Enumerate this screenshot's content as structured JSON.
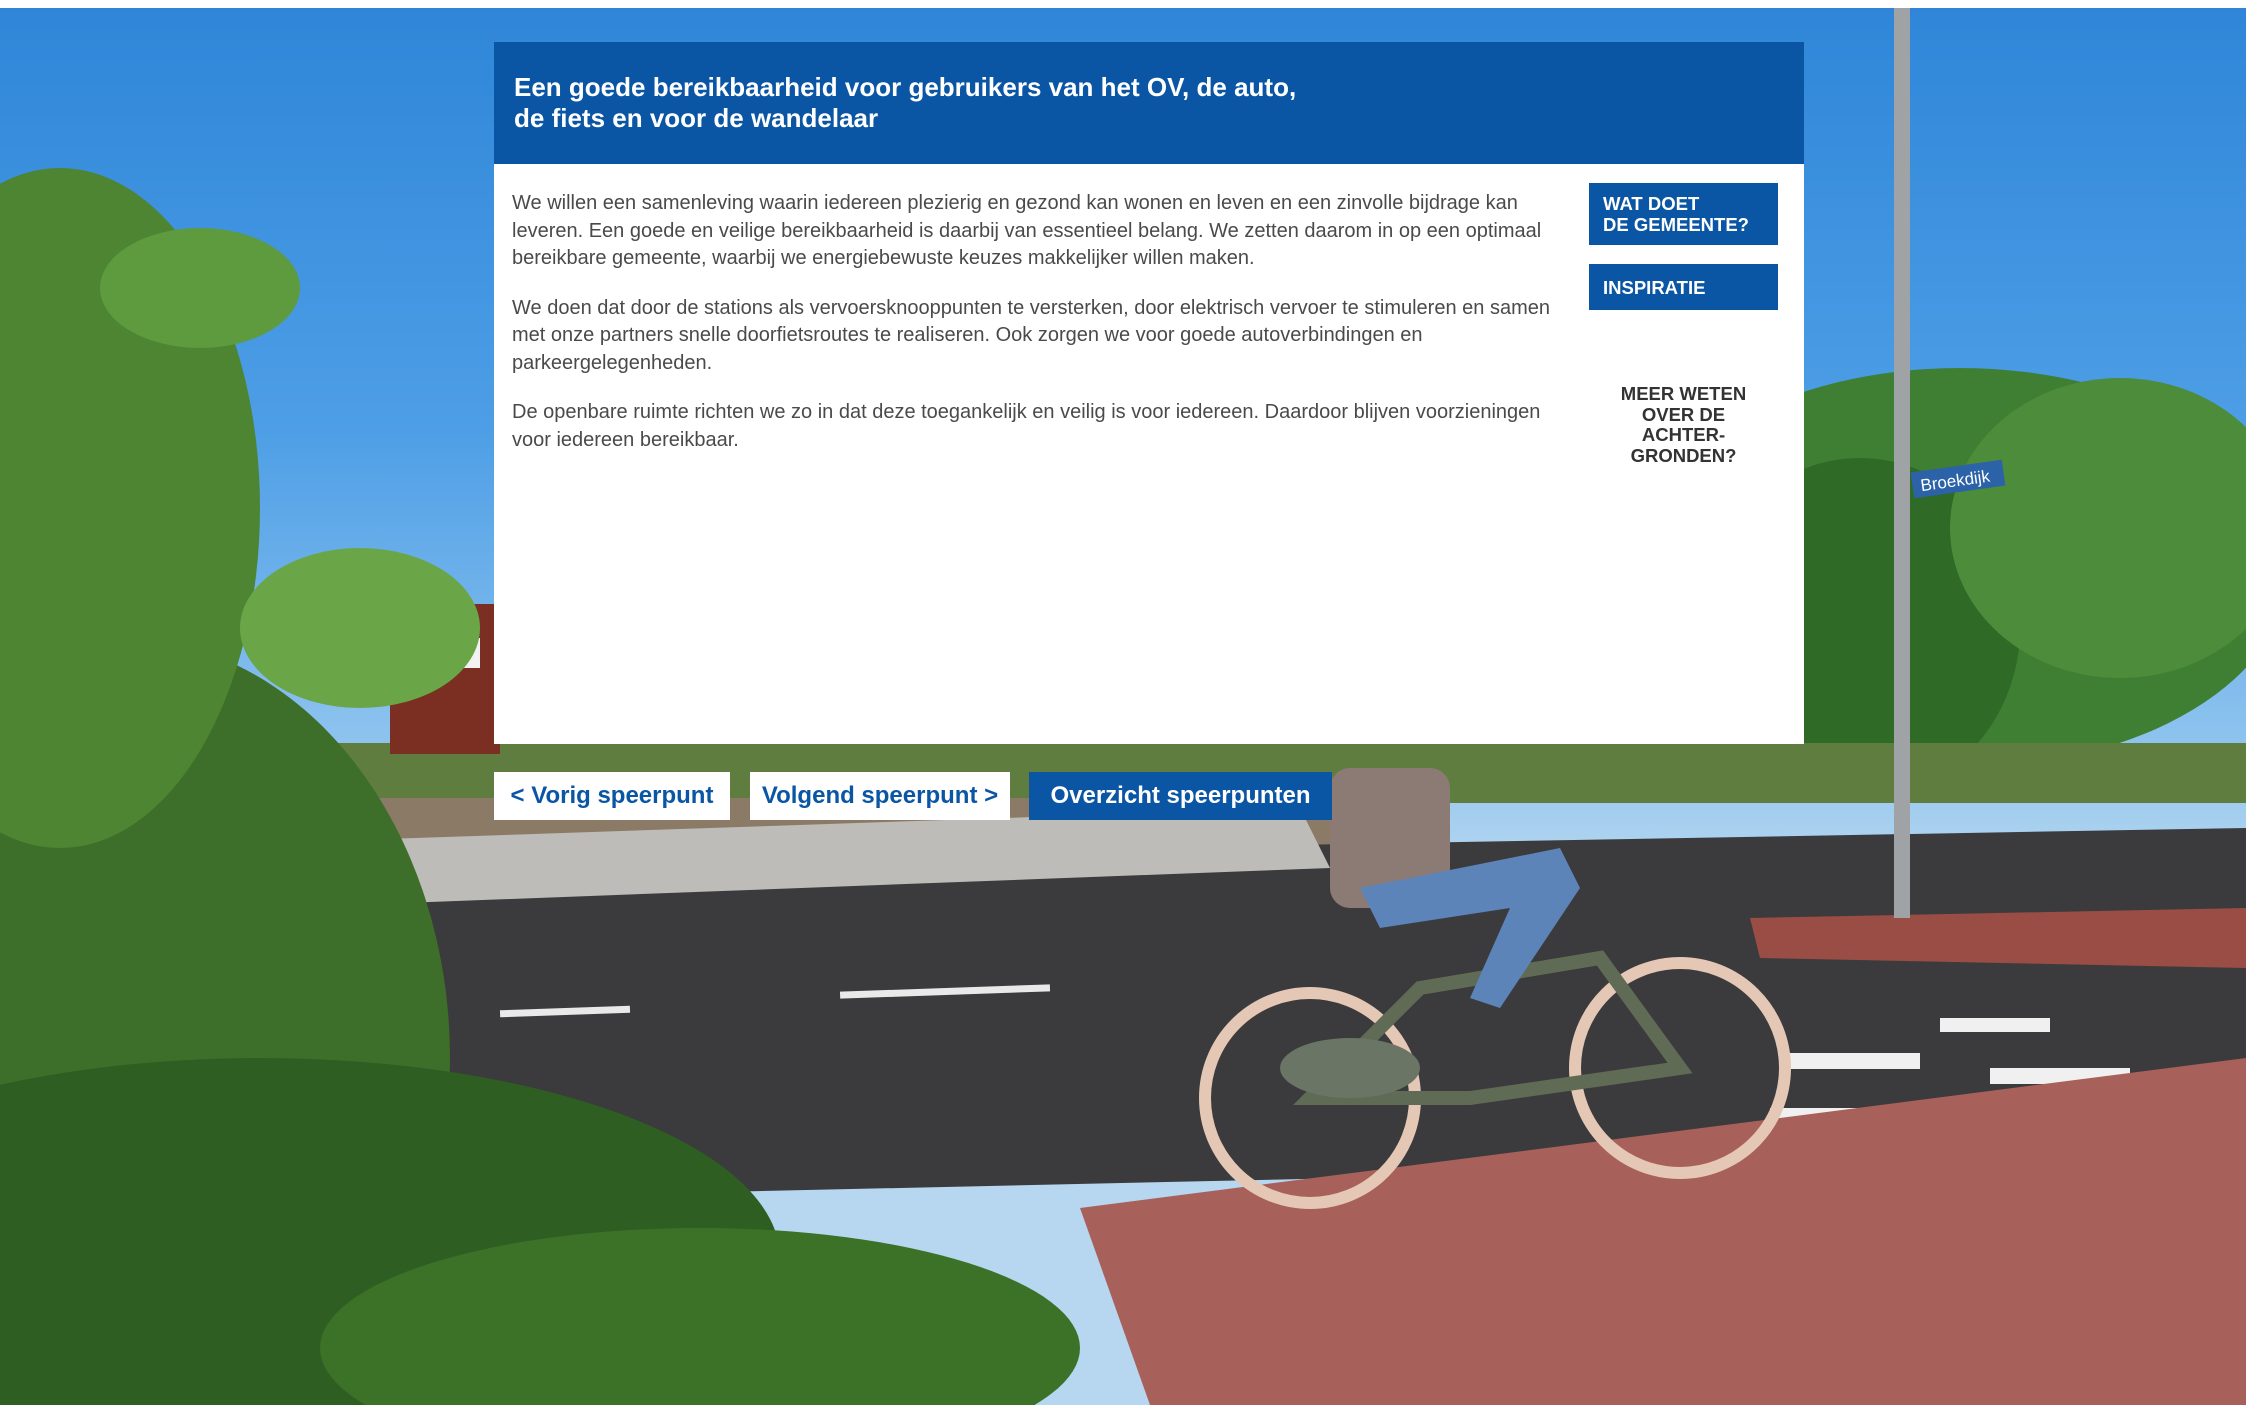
{
  "dialog": {
    "title_lines": [
      "Een goede bereikbaarheid voor gebruikers van het OV, de auto,",
      "de fiets en voor de wandelaar"
    ],
    "paragraphs": [
      "We willen een samenleving waarin iedereen plezierig en gezond kan wonen en leven en een zinvolle bijdrage kan leveren. Een goede en veilige bereikbaarheid is daarbij van essentieel belang. We zetten daarom in op een optimaal bereikbare gemeente, waarbij we energiebewuste keuzes makkelijker willen maken.",
      "We doen dat door de stations als vervoersknooppunten te versterken, door elektrisch vervoer te stimuleren en samen met onze partners snelle doorfietsroutes te realiseren. Ook zorgen we voor goede autoverbindingen en parkeergelegenheden.",
      "De openbare ruimte richten we zo in dat deze toegankelijk en veilig is voor iedereen. Daardoor blijven voorzieningen voor iedereen bereikbaar."
    ],
    "side_buttons": {
      "wat_doet_lines": [
        "WAT DOET",
        "DE GEMEENTE?"
      ],
      "inspiratie": "INSPIRATIE"
    },
    "meer_weten_lines": [
      "MEER WETEN",
      "OVER DE",
      "ACHTER-",
      "GRONDEN?"
    ]
  },
  "navigation": {
    "prev": "< Vorig speerpunt",
    "next": "Volgend speerpunt >",
    "overview": "Overzicht speerpunten"
  },
  "background": {
    "street_sign": "Broekdijk"
  },
  "colors": {
    "brand_blue": "#0b56a4",
    "text_gray": "#4a4a4a"
  }
}
